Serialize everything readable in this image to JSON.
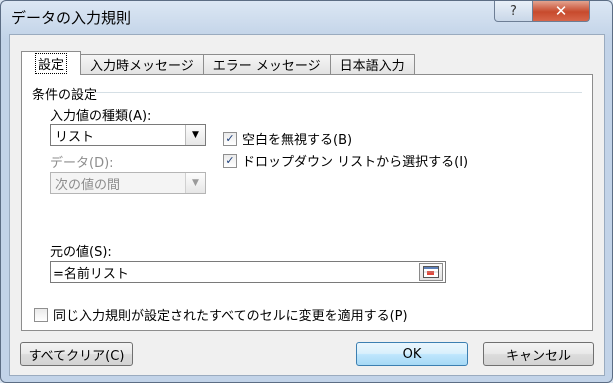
{
  "window": {
    "title": "データの入力規則",
    "help_label": "?",
    "close_label": "✕"
  },
  "tabs": [
    {
      "label": "設定",
      "active": true
    },
    {
      "label": "入力時メッセージ",
      "active": false
    },
    {
      "label": "エラー メッセージ",
      "active": false
    },
    {
      "label": "日本語入力",
      "active": false
    }
  ],
  "settings": {
    "group_title": "条件の設定",
    "allow_label": "入力値の種類(A):",
    "allow_value": "リスト",
    "data_label": "データ(D):",
    "data_value": "次の値の間",
    "ignore_blank_label": "空白を無視する(B)",
    "ignore_blank_checked": true,
    "dropdown_label": "ドロップダウン リストから選択する(I)",
    "dropdown_checked": true,
    "source_label": "元の値(S):",
    "source_value": "=名前リスト",
    "apply_all_label": "同じ入力規則が設定されたすべてのセルに変更を適用する(P)",
    "apply_all_checked": false
  },
  "buttons": {
    "clear_all": "すべてクリア(C)",
    "ok": "OK",
    "cancel": "キャンセル"
  },
  "icons": {
    "collapse_dialog": "range-select-icon",
    "dropdown": "chevron-down-icon",
    "check": "checkmark-icon"
  }
}
